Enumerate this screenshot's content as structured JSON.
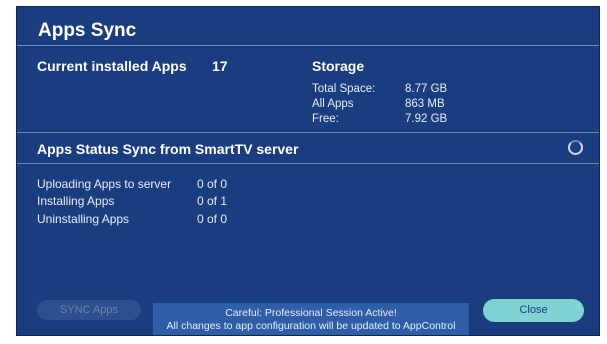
{
  "title": "Apps Sync",
  "current_apps": {
    "label": "Current installed Apps",
    "value": "17"
  },
  "storage": {
    "title": "Storage",
    "rows": [
      {
        "label": "Total Space:",
        "value": "8.77 GB"
      },
      {
        "label": "All Apps",
        "value": "863 MB"
      },
      {
        "label": "Free:",
        "value": "7.92 GB"
      }
    ]
  },
  "sync_section": {
    "title": "Apps Status Sync from SmartTV server",
    "spinner_icon": "loading-spinner-icon",
    "rows": [
      {
        "label": "Uploading Apps to server",
        "value": "0 of 0"
      },
      {
        "label": "Installing Apps",
        "value": "0 of 1"
      },
      {
        "label": "Uninstalling Apps",
        "value": "0 of 0"
      }
    ]
  },
  "buttons": {
    "sync": "SYNC Apps",
    "close": "Close"
  },
  "notice": {
    "line1": "Careful: Professional Session Active!",
    "line2": "All changes to app configuration will be updated to AppControl"
  },
  "colors": {
    "panel_bg": "#1a3d80",
    "notice_bg": "#2f5ea8",
    "close_button": "#7fd4d3",
    "sync_button_disabled": "#2b4f8f"
  }
}
